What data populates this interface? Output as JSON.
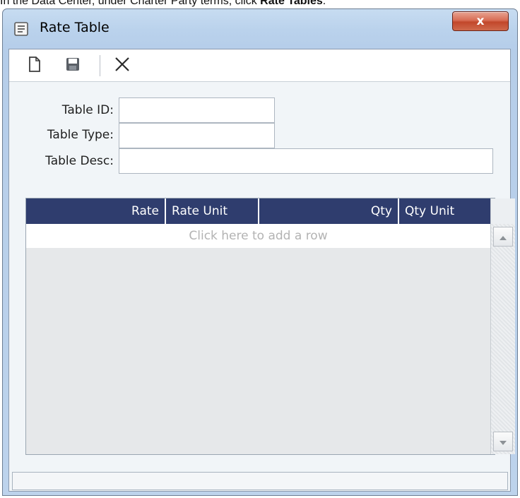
{
  "caption": {
    "prefix": "In the Data Center, under Charter Party terms, click ",
    "bold": "Rate Tables",
    "suffix": "."
  },
  "window": {
    "title": "Rate Table",
    "close_label": "x"
  },
  "toolbar": {
    "new_icon": "new-document-icon",
    "save_icon": "save-icon",
    "delete_icon": "delete-x-icon"
  },
  "form": {
    "table_id_label": "Table ID:",
    "table_id_value": "",
    "table_type_label": "Table Type:",
    "table_type_value": "",
    "table_desc_label": "Table Desc:",
    "table_desc_value": ""
  },
  "grid": {
    "columns": [
      "Rate",
      "Rate Unit",
      "Qty",
      "Qty Unit"
    ],
    "add_row_text": "Click here to add a row",
    "header_color": "#2f3d6e"
  }
}
